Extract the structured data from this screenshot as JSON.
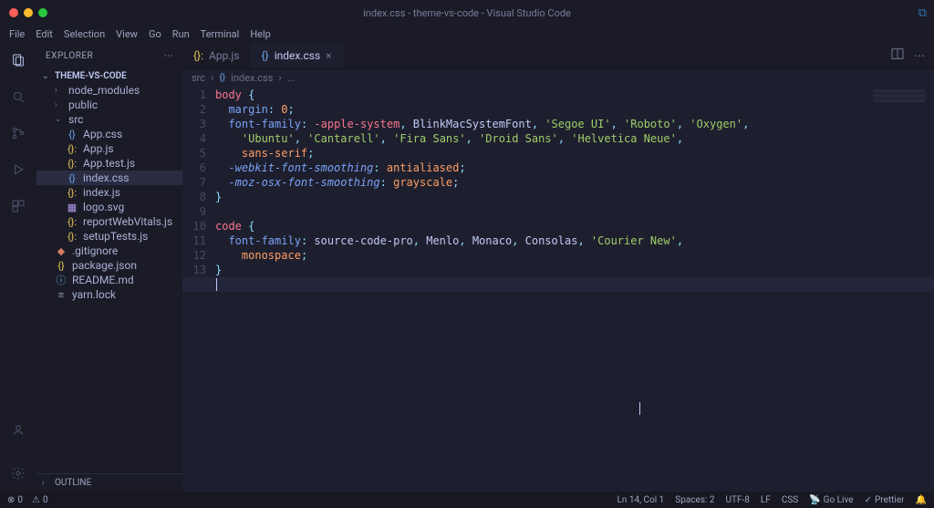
{
  "window": {
    "title": "index.css - theme-vs-code - Visual Studio Code"
  },
  "menu": [
    "File",
    "Edit",
    "Selection",
    "View",
    "Go",
    "Run",
    "Terminal",
    "Help"
  ],
  "sidebar": {
    "title": "EXPLORER",
    "project": "THEME-VS-CODE",
    "outline": "OUTLINE",
    "items": [
      {
        "label": "node_modules",
        "type": "folder-closed",
        "indent": 1
      },
      {
        "label": "public",
        "type": "folder-closed",
        "indent": 1
      },
      {
        "label": "src",
        "type": "folder-open",
        "indent": 1
      },
      {
        "label": "App.css",
        "type": "css",
        "indent": 2
      },
      {
        "label": "App.js",
        "type": "js",
        "indent": 2
      },
      {
        "label": "App.test.js",
        "type": "js",
        "indent": 2
      },
      {
        "label": "index.css",
        "type": "css",
        "indent": 2,
        "selected": true
      },
      {
        "label": "index.js",
        "type": "js",
        "indent": 2
      },
      {
        "label": "logo.svg",
        "type": "svg",
        "indent": 2
      },
      {
        "label": "reportWebVitals.js",
        "type": "js",
        "indent": 2
      },
      {
        "label": "setupTests.js",
        "type": "js",
        "indent": 2
      },
      {
        "label": ".gitignore",
        "type": "git",
        "indent": 1
      },
      {
        "label": "package.json",
        "type": "json",
        "indent": 1
      },
      {
        "label": "README.md",
        "type": "md",
        "indent": 1
      },
      {
        "label": "yarn.lock",
        "type": "lock",
        "indent": 1
      }
    ]
  },
  "tabs": [
    {
      "label": "App.js",
      "icon": "js",
      "active": false
    },
    {
      "label": "index.css",
      "icon": "css",
      "active": true
    }
  ],
  "breadcrumb": {
    "parts": [
      "src",
      "index.css",
      "..."
    ]
  },
  "code": {
    "lineCount": 14,
    "activeLine": 14,
    "cursorCol": 1
  },
  "status": {
    "errors": "0",
    "warnings": "0",
    "lncol": "Ln 14, Col 1",
    "spaces": "Spaces: 2",
    "encoding": "UTF-8",
    "eol": "LF",
    "lang": "CSS",
    "golive": "Go Live",
    "prettier": "Prettier"
  }
}
